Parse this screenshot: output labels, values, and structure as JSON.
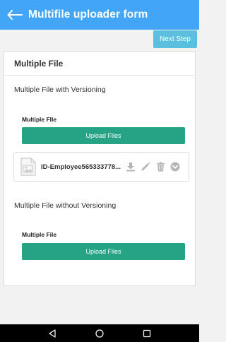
{
  "app": {
    "title": "Multifile uploader form"
  },
  "toolbar": {
    "next_label": "Next Step"
  },
  "card": {
    "title": "Multiple File",
    "section1": {
      "heading": "Multiple File with Versioning",
      "field_label": "Multiple FIle",
      "upload_label": "Upload Files",
      "files": [
        {
          "name": "ID-Employee565333778..."
        }
      ]
    },
    "section2": {
      "heading": "Multiple File without Versioning",
      "field_label": "Multiple File",
      "upload_label": "Upload Files"
    }
  },
  "icons": {
    "back": "arrow-left-icon",
    "file": "image-file-icon",
    "download": "download-icon",
    "edit": "pencil-icon",
    "delete": "trash-icon",
    "expand": "chevron-down-icon"
  },
  "colors": {
    "appbar": "#42a5f5",
    "next_button": "#5bc0de",
    "upload_button": "#26a284"
  }
}
